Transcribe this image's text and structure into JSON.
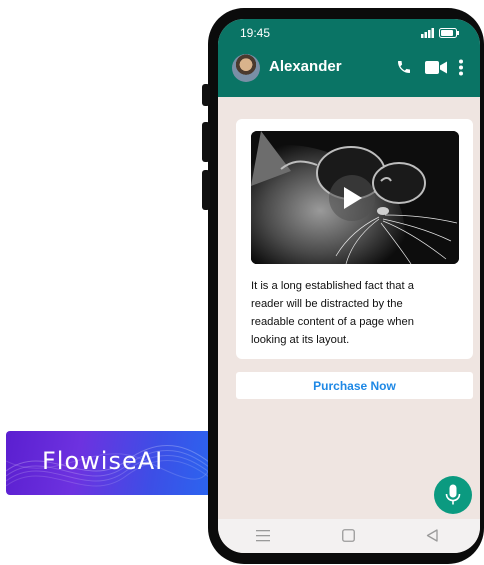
{
  "brand": {
    "name": "FlowiseAI"
  },
  "status_bar": {
    "time": "19:45"
  },
  "chat_header": {
    "contact_name": "Alexander"
  },
  "message": {
    "text": "It is a long established fact that a\n reader will be distracted by the\nreadable content of a page when\nlooking at its layout."
  },
  "cta": {
    "label": "Purchase Now"
  },
  "icons": {
    "status": [
      "signal-icon",
      "battery-icon"
    ],
    "header": [
      "avatar",
      "phone-icon",
      "video-call-icon",
      "more-options-icon"
    ],
    "composer": [
      "emoji-icon",
      "attachment-icon",
      "camera-icon",
      "microphone-icon"
    ],
    "nav": [
      "menu-icon",
      "home-icon",
      "back-icon"
    ]
  },
  "colors": {
    "header": "#0a7465",
    "chat_background": "#efe5e1",
    "link": "#1e88e5",
    "mic_button": "#0b9a80"
  }
}
